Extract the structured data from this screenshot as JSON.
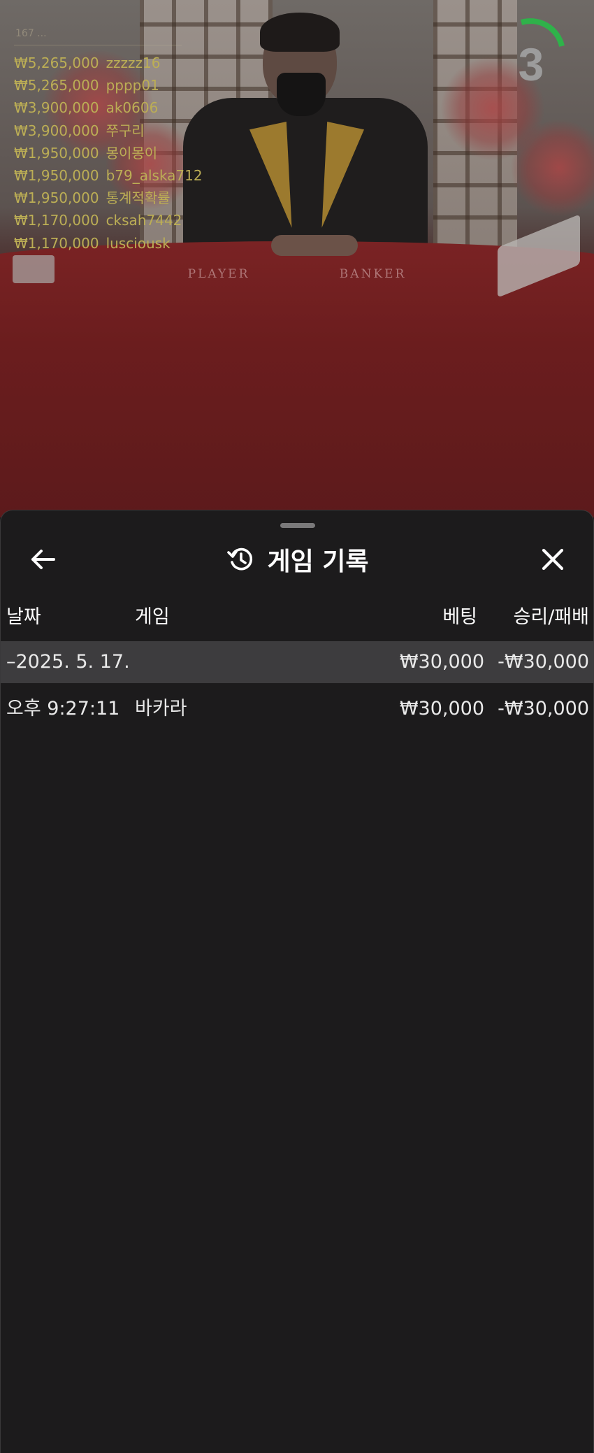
{
  "stream": {
    "table_labels": [
      "PLAYER",
      "BANKER"
    ],
    "timer_value": "3",
    "timer_color": "#2fb24a",
    "winners_header": "167 ...",
    "winners": [
      {
        "amount": "₩5,265,000",
        "user": "zzzzz16"
      },
      {
        "amount": "₩5,265,000",
        "user": "pppp01"
      },
      {
        "amount": "₩3,900,000",
        "user": "ak0606"
      },
      {
        "amount": "₩3,900,000",
        "user": "쭈구리"
      },
      {
        "amount": "₩1,950,000",
        "user": "몽이몽이"
      },
      {
        "amount": "₩1,950,000",
        "user": "b79_alska712"
      },
      {
        "amount": "₩1,950,000",
        "user": "통계적확률"
      },
      {
        "amount": "₩1,170,000",
        "user": "cksah7442"
      },
      {
        "amount": "₩1,170,000",
        "user": "lusciousk"
      }
    ],
    "winner_color": "#bcae55"
  },
  "sheet": {
    "title": "게임 기록",
    "icons": {
      "back": "arrow-left-icon",
      "history": "history-icon",
      "close": "close-icon"
    },
    "columns": {
      "date": "날짜",
      "game": "게임",
      "bet": "베팅",
      "result": "승리/패배"
    },
    "date_group": {
      "label": "–2025. 5. 17.",
      "bet": "₩30,000",
      "result": "-₩30,000"
    },
    "entries": [
      {
        "time": "오후 9:27:11",
        "game": "바카라",
        "bet": "₩30,000",
        "result": "-₩30,000"
      }
    ]
  }
}
